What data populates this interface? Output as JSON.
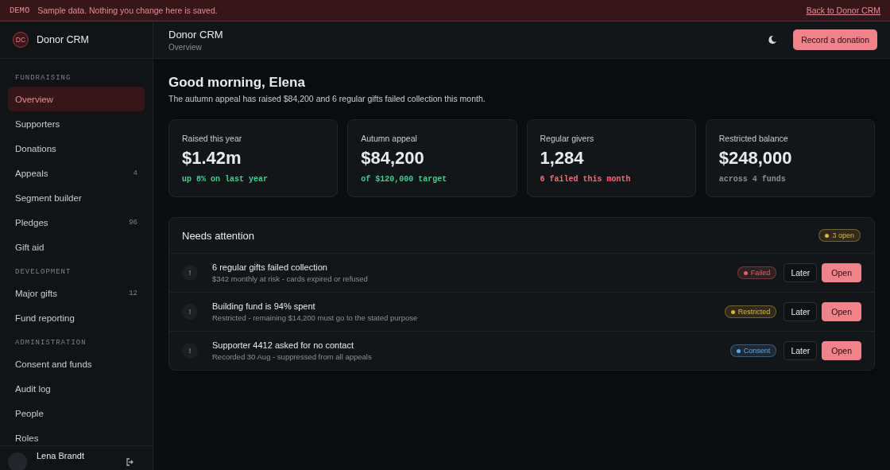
{
  "banner": {
    "tag": "DEMO",
    "message": "Sample data. Nothing you change here is saved.",
    "link": "Back to Donor CRM"
  },
  "sidebar": {
    "logo": "DC",
    "app_name": "Donor CRM",
    "sections": [
      {
        "heading": "FUNDRAISING",
        "items": [
          {
            "label": "Overview",
            "selected": true
          },
          {
            "label": "Supporters",
            "selected": false
          },
          {
            "label": "Donations",
            "selected": false
          },
          {
            "label": "Appeals",
            "count": "4",
            "selected": false
          },
          {
            "label": "Segment builder",
            "selected": false
          },
          {
            "label": "Pledges",
            "count": "96",
            "selected": false
          },
          {
            "label": "Gift aid",
            "selected": false
          }
        ]
      },
      {
        "heading": "DEVELOPMENT",
        "items": [
          {
            "label": "Major gifts",
            "count": "12",
            "selected": false
          },
          {
            "label": "Fund reporting",
            "selected": false
          }
        ]
      },
      {
        "heading": "ADMINISTRATION",
        "items": [
          {
            "label": "Consent and funds",
            "selected": false
          },
          {
            "label": "Audit log",
            "selected": false
          },
          {
            "label": "People",
            "selected": false
          },
          {
            "label": "Roles",
            "selected": false
          }
        ]
      }
    ],
    "user": {
      "name": "Lena Brandt"
    }
  },
  "header": {
    "title": "Donor CRM",
    "subtitle": "Overview",
    "primary_button": "Record a donation"
  },
  "greeting": {
    "title": "Good morning, Elena",
    "summary": "The autumn appeal has raised $84,200 and 6 regular gifts failed collection this month."
  },
  "stats": [
    {
      "label": "Raised this year",
      "value": "$1.42m",
      "note": "up 8% on last year",
      "color": "#3fcf8e"
    },
    {
      "label": "Autumn appeal",
      "value": "$84,200",
      "note": "of $120,000 target",
      "color": "#3fcf8e"
    },
    {
      "label": "Regular givers",
      "value": "1,284",
      "note": "6 failed this month",
      "color": "#f0707a"
    },
    {
      "label": "Restricted balance",
      "value": "$248,000",
      "note": "across 4 funds",
      "color": "#8a8f96"
    }
  ],
  "attention": {
    "title": "Needs attention",
    "badge": {
      "label": "3 open",
      "color": "#e0b341"
    },
    "items": [
      {
        "icon": "!",
        "title": "6 regular gifts failed collection",
        "detail": "$342 monthly at risk - cards expired or refused",
        "tag": {
          "label": "Failed",
          "color": "#e5606a"
        },
        "actions": [
          "Later",
          "Open"
        ]
      },
      {
        "icon": "!",
        "title": "Building fund is 94% spent",
        "detail": "Restricted - remaining $14,200 must go to the stated purpose",
        "tag": {
          "label": "Restricted",
          "color": "#e0b341"
        },
        "actions": [
          "Later",
          "Open"
        ]
      },
      {
        "icon": "!",
        "title": "Supporter 4412 asked for no contact",
        "detail": "Recorded 30 Aug - suppressed from all appeals",
        "tag": {
          "label": "Consent",
          "color": "#5ea8e8"
        },
        "actions": [
          "Later",
          "Open"
        ]
      }
    ]
  }
}
